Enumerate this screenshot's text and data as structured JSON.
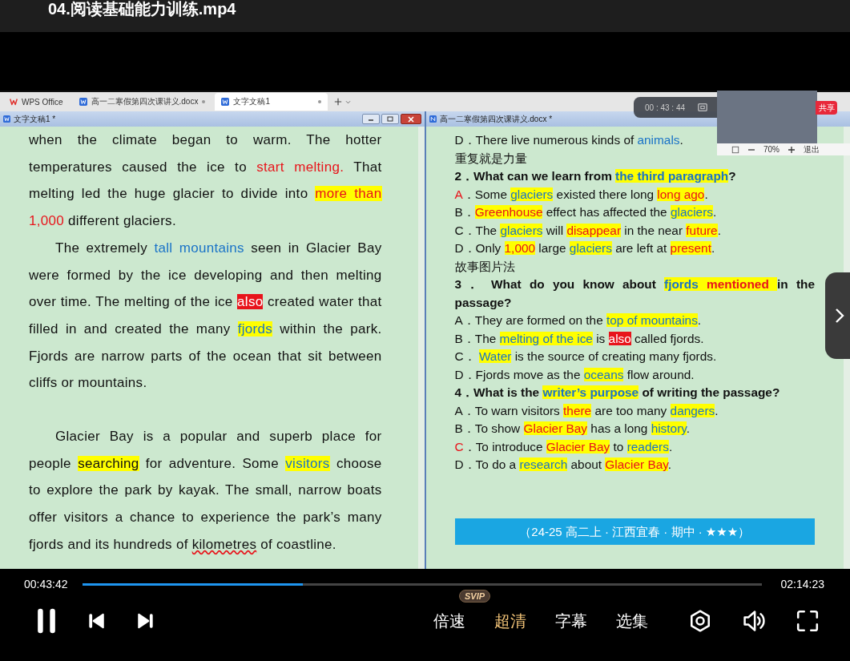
{
  "player": {
    "title": "04.阅读基础能力训练.mp4"
  },
  "app_tabs": [
    {
      "label": "WPS Office",
      "kind": "home",
      "selected": false
    },
    {
      "label": "高一二寒假第四次课讲义.docx",
      "kind": "doc",
      "selected": false
    },
    {
      "label": "文字文稿1",
      "kind": "doc",
      "selected": true
    }
  ],
  "left_window": {
    "title": "文字文稿1 *",
    "paragraphs": [
      {
        "indent": false,
        "segments": [
          {
            "text": "when the climate began to warm. The hotter temperatures caused the ice to ",
            "kind": "plain"
          },
          {
            "text": "start melting.",
            "kind": "red"
          },
          {
            "text": " That melting led the huge glacier to divide into ",
            "kind": "plain"
          },
          {
            "text": "more than",
            "kind": "hlr"
          },
          {
            "text": " 1,000",
            "kind": "red"
          },
          {
            "text": " different glaciers.",
            "kind": "plain"
          }
        ]
      },
      {
        "indent": true,
        "segments": [
          {
            "text": "The extremely ",
            "kind": "plain"
          },
          {
            "text": "tall mountains",
            "kind": "blue"
          },
          {
            "text": " seen in Glacier Bay were formed by the ice developing and then melting over time. The melting of the ice ",
            "kind": "plain"
          },
          {
            "text": "also",
            "kind": "alert"
          },
          {
            "text": " created water that filled in and created the many ",
            "kind": "plain"
          },
          {
            "text": "fjords",
            "kind": "hlb"
          },
          {
            "text": " within the park. Fjords are narrow parts of the ocean that sit between cliffs or mountains.",
            "kind": "plain"
          }
        ]
      },
      {
        "indent": true,
        "segments": [
          {
            "text": "Glacier Bay is a popular and superb place for people ",
            "kind": "plain"
          },
          {
            "text": "searching",
            "kind": "hl"
          },
          {
            "text": " for adventure. Some ",
            "kind": "plain"
          },
          {
            "text": "visitors",
            "kind": "hlb"
          },
          {
            "text": " choose to explore the park by kayak. The small, narrow boats offer visitors a chance to experience the park’s many fjords and its hundreds of ",
            "kind": "plain"
          },
          {
            "text": "kilometres",
            "kind": "spell"
          },
          {
            "text": " of coastline.",
            "kind": "plain"
          }
        ]
      }
    ]
  },
  "right_window": {
    "title": "高一二寒假第四次课讲义.docx *",
    "lines": [
      {
        "kind": "option",
        "segments": [
          {
            "text": "D．There live numerous kinds of ",
            "kind": "plain"
          },
          {
            "text": "animals",
            "kind": "blue"
          },
          {
            "text": ".",
            "kind": "plain"
          }
        ]
      },
      {
        "kind": "note",
        "segments": [
          {
            "text": "重复就是力量",
            "kind": "plain"
          }
        ]
      },
      {
        "kind": "question",
        "segments": [
          {
            "text": "2．What can we learn from ",
            "kind": "plain"
          },
          {
            "text": "the third paragraph",
            "kind": "hlb"
          },
          {
            "text": "?",
            "kind": "plain"
          }
        ]
      },
      {
        "kind": "option",
        "segments": [
          {
            "text": "A",
            "kind": "red"
          },
          {
            "text": "．Some ",
            "kind": "plain"
          },
          {
            "text": "glaciers",
            "kind": "hlb"
          },
          {
            "text": " existed there long ",
            "kind": "plain"
          },
          {
            "text": "long ago",
            "kind": "hlr"
          },
          {
            "text": ".",
            "kind": "plain"
          }
        ]
      },
      {
        "kind": "option",
        "segments": [
          {
            "text": "B．",
            "kind": "plain"
          },
          {
            "text": "Greenhouse",
            "kind": "hlr"
          },
          {
            "text": " effect has affected the ",
            "kind": "plain"
          },
          {
            "text": "glaciers",
            "kind": "hlb"
          },
          {
            "text": ".",
            "kind": "plain"
          }
        ]
      },
      {
        "kind": "option",
        "segments": [
          {
            "text": "C．The ",
            "kind": "plain"
          },
          {
            "text": "glaciers",
            "kind": "hlb"
          },
          {
            "text": " will ",
            "kind": "plain"
          },
          {
            "text": "disappear",
            "kind": "hlr"
          },
          {
            "text": " in the near ",
            "kind": "plain"
          },
          {
            "text": "future",
            "kind": "hlr"
          },
          {
            "text": ".",
            "kind": "plain"
          }
        ]
      },
      {
        "kind": "option",
        "segments": [
          {
            "text": "D．Only ",
            "kind": "plain"
          },
          {
            "text": "1,000",
            "kind": "hlr"
          },
          {
            "text": " large ",
            "kind": "plain"
          },
          {
            "text": "glaciers",
            "kind": "hlb"
          },
          {
            "text": " are left at ",
            "kind": "plain"
          },
          {
            "text": "present",
            "kind": "hlr"
          },
          {
            "text": ".",
            "kind": "plain"
          }
        ]
      },
      {
        "kind": "note",
        "segments": [
          {
            "text": "故事图片法",
            "kind": "plain"
          }
        ]
      },
      {
        "kind": "question",
        "segments": [
          {
            "text": "3． What do you know about ",
            "kind": "plain"
          },
          {
            "text": "fjords",
            "kind": "hlb"
          },
          {
            "text": " mentioned ",
            "kind": "hlr"
          },
          {
            "text": " in the passage?",
            "kind": "plain"
          }
        ]
      },
      {
        "kind": "option",
        "segments": [
          {
            "text": "A．They are formed on the ",
            "kind": "plain"
          },
          {
            "text": "top of mountains",
            "kind": "hlb"
          },
          {
            "text": ".",
            "kind": "plain"
          }
        ]
      },
      {
        "kind": "option",
        "segments": [
          {
            "text": "B．The ",
            "kind": "plain"
          },
          {
            "text": "melting of the ice",
            "kind": "hlb"
          },
          {
            "text": " is ",
            "kind": "plain"
          },
          {
            "text": "also",
            "kind": "alert"
          },
          {
            "text": " called fjords.",
            "kind": "plain"
          }
        ]
      },
      {
        "kind": "option",
        "segments": [
          {
            "text": "C． ",
            "kind": "plain"
          },
          {
            "text": "Water",
            "kind": "hlb"
          },
          {
            "text": " is the source of creating many fjords.",
            "kind": "plain"
          }
        ]
      },
      {
        "kind": "option",
        "segments": [
          {
            "text": "D．Fjords move as the ",
            "kind": "plain"
          },
          {
            "text": "oceans",
            "kind": "hlb"
          },
          {
            "text": " flow around.",
            "kind": "plain"
          }
        ]
      },
      {
        "kind": "question",
        "segments": [
          {
            "text": "4．What is the ",
            "kind": "plain"
          },
          {
            "text": "writer’s purpose",
            "kind": "hlb"
          },
          {
            "text": " of writing the passage?",
            "kind": "plain"
          }
        ]
      },
      {
        "kind": "option",
        "segments": [
          {
            "text": "A．To warn visitors ",
            "kind": "plain"
          },
          {
            "text": "there",
            "kind": "hlr"
          },
          {
            "text": " are too many ",
            "kind": "plain"
          },
          {
            "text": "dangers",
            "kind": "hlb"
          },
          {
            "text": ".",
            "kind": "plain"
          }
        ]
      },
      {
        "kind": "option",
        "segments": [
          {
            "text": "B．To show ",
            "kind": "plain"
          },
          {
            "text": "Glacier Bay",
            "kind": "hlr"
          },
          {
            "text": " has a long ",
            "kind": "plain"
          },
          {
            "text": "history",
            "kind": "hlb"
          },
          {
            "text": ".",
            "kind": "plain"
          }
        ]
      },
      {
        "kind": "option",
        "segments": [
          {
            "text": "C",
            "kind": "red"
          },
          {
            "text": "．To introduce ",
            "kind": "plain"
          },
          {
            "text": "Glacier Bay",
            "kind": "hlr"
          },
          {
            "text": " to ",
            "kind": "plain"
          },
          {
            "text": "readers",
            "kind": "hlb"
          },
          {
            "text": ".",
            "kind": "plain"
          }
        ]
      },
      {
        "kind": "option",
        "segments": [
          {
            "text": "D．To do a ",
            "kind": "plain"
          },
          {
            "text": "research",
            "kind": "hlb"
          },
          {
            "text": " about ",
            "kind": "plain"
          },
          {
            "text": "Glacier Bay",
            "kind": "hlr"
          },
          {
            "text": ".",
            "kind": "plain"
          }
        ]
      }
    ],
    "banner": "（24-25 高二上 · 江西宜春 · 期中 · ★★★）"
  },
  "recorder": {
    "time": "00 : 43 : 44",
    "share": "共享",
    "zoom": "70%",
    "exit": "退出"
  },
  "controls": {
    "elapsed": "00:43:42",
    "duration": "02:14:23",
    "level": 0.325,
    "playing": true,
    "buttons": [
      {
        "label": "倍速",
        "badge": "SVIP",
        "active": false
      },
      {
        "label": "超清",
        "active": true
      },
      {
        "label": "字幕",
        "active": false
      },
      {
        "label": "选集",
        "active": false
      }
    ]
  }
}
